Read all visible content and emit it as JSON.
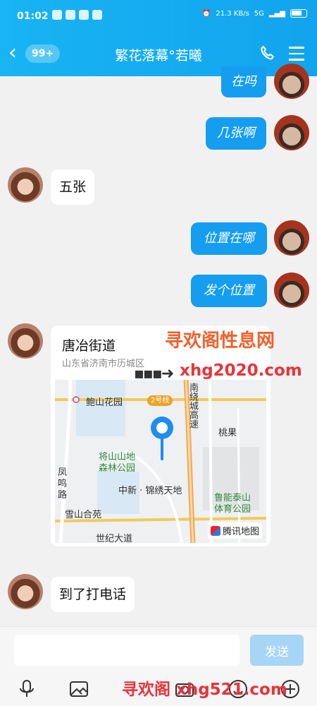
{
  "status_bar": {
    "time": "01:02",
    "speed": "21.3 KB/s",
    "network": "5G"
  },
  "header": {
    "back_icon": "chevron-left-icon",
    "unread_count": "99+",
    "title": "繁花落幕°若曦",
    "phone_icon": "phone-icon",
    "menu_icon": "menu-icon"
  },
  "messages": [
    {
      "from": "me",
      "text": "在吗"
    },
    {
      "from": "me",
      "text": "几张啊"
    },
    {
      "from": "her",
      "text": "五张"
    },
    {
      "from": "me",
      "text": "位置在哪"
    },
    {
      "from": "me",
      "text": "发个位置"
    },
    {
      "from": "her",
      "type": "location",
      "title": "唐冶街道",
      "address": "山东省济南市历城区",
      "map_labels": {
        "park1": "鲍山花园",
        "line": "2号线",
        "road_vertical": "南绕城高速",
        "taoguo": "桃果",
        "forest_park_1": "将山山地",
        "forest_park_2": "森林公园",
        "fengming_1": "凤",
        "fengming_2": "鸣",
        "fengming_3": "路",
        "zhongxin": "中新 · 锦绣天地",
        "xueshan": "雪山合苑",
        "luneng_1": "鲁能泰山",
        "luneng_2": "体育公园",
        "century": "世纪大道",
        "brand": "腾讯地图"
      }
    },
    {
      "from": "her",
      "text": "到了打电话"
    }
  ],
  "watermarks": {
    "top": "寻欢阁性息网",
    "url1": "xhg2020.com",
    "bottom": "寻欢阁 xhg521.com"
  },
  "input": {
    "placeholder": "",
    "send_label": "发送"
  },
  "toolbar": [
    "microphone-icon",
    "image-icon",
    "camera-icon",
    "emoji-icon",
    "plus-icon"
  ],
  "colors": {
    "accent": "#12a4ee",
    "bubble_me": "#159df0",
    "send_disabled": "#a7d5f6"
  }
}
